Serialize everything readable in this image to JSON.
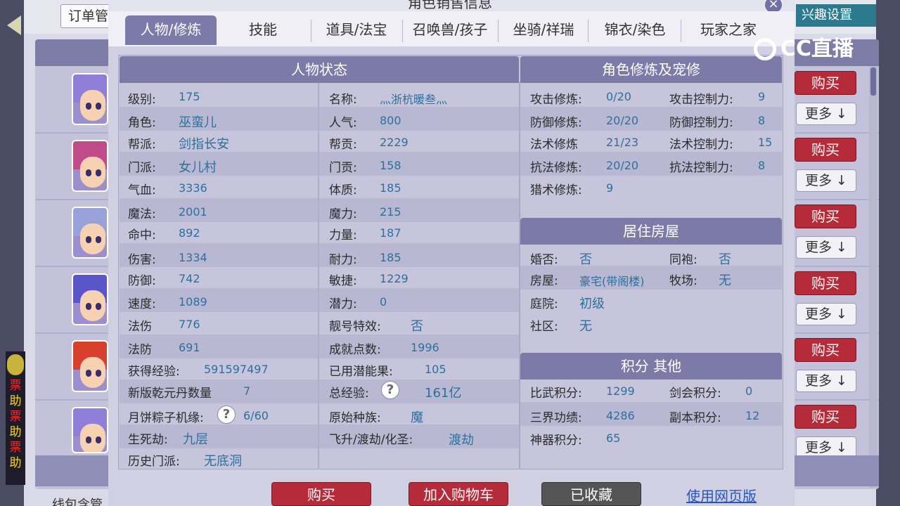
{
  "background": {
    "order_label": "订单管",
    "buy_label": "购买",
    "more_label": "更多 ↓",
    "brand_text": "兴趣设置",
    "bottom_text": "线包含管",
    "left_strip_glyphs": [
      "票",
      "助",
      "票",
      "助",
      "票",
      "助"
    ]
  },
  "dialog": {
    "title": "角色销售信息",
    "close": "×"
  },
  "tabs": [
    {
      "label": "人物/修炼"
    },
    {
      "label": "技能"
    },
    {
      "label": "道具/法宝"
    },
    {
      "label": "召唤兽/孩子"
    },
    {
      "label": "坐骑/祥瑞"
    },
    {
      "label": "锦衣/染色"
    },
    {
      "label": "玩家之家"
    }
  ],
  "watermark": "CC直播",
  "sections": {
    "status": "人物状态",
    "cultivation": "角色修炼及宠修",
    "house": "居住房屋",
    "points": "积分 其他"
  },
  "status_left": [
    {
      "label": "级别:",
      "value": "175"
    },
    {
      "label": "角色:",
      "value": "巫蛮儿"
    },
    {
      "label": "帮派:",
      "value": "剑指长安"
    },
    {
      "label": "门派:",
      "value": "女儿村"
    },
    {
      "label": "气血:",
      "value": "3336"
    },
    {
      "label": "魔法:",
      "value": "2001"
    },
    {
      "label": "命中:",
      "value": "892"
    },
    {
      "label": "伤害:",
      "value": "1334"
    },
    {
      "label": "防御:",
      "value": "742"
    },
    {
      "label": "速度:",
      "value": "1089"
    },
    {
      "label": "法伤",
      "value": "776"
    },
    {
      "label": "法防",
      "value": "691"
    },
    {
      "label": "获得经验:",
      "value": "591597497"
    },
    {
      "label": "新版乾元丹数量",
      "value": "7"
    },
    {
      "label": "月饼粽子机缘:",
      "value": "6/60"
    },
    {
      "label": "生死劫:",
      "value": "九层"
    },
    {
      "label": "历史门派:",
      "value": "无底洞"
    }
  ],
  "status_right": [
    {
      "label": "名称:",
      "value": "灬浙杭暖叁灬"
    },
    {
      "label": "人气:",
      "value": "800"
    },
    {
      "label": "帮贡:",
      "value": "2229"
    },
    {
      "label": "门贡:",
      "value": "158"
    },
    {
      "label": "体质:",
      "value": "185"
    },
    {
      "label": "魔力:",
      "value": "215"
    },
    {
      "label": "力量:",
      "value": "187"
    },
    {
      "label": "耐力:",
      "value": "185"
    },
    {
      "label": "敏捷:",
      "value": "1229"
    },
    {
      "label": "潜力:",
      "value": "0"
    },
    {
      "label": "靓号特效:",
      "value": "否"
    },
    {
      "label": "成就点数:",
      "value": "1996"
    },
    {
      "label": "已用潜能果:",
      "value": "105"
    },
    {
      "label": "总经验:",
      "value": "161亿"
    },
    {
      "label": "原始种族:",
      "value": "魔"
    },
    {
      "label": "飞升/渡劫/化圣:",
      "value": "渡劫"
    }
  ],
  "cultivation": [
    {
      "label": "攻击修炼:",
      "value": "0/20",
      "label2": "攻击控制力:",
      "value2": "9"
    },
    {
      "label": "防御修炼:",
      "value": "20/20",
      "label2": "防御控制力:",
      "value2": "8"
    },
    {
      "label": "法术修炼",
      "value": "21/23",
      "label2": "法术控制力:",
      "value2": "15"
    },
    {
      "label": "抗法修炼:",
      "value": "20/20",
      "label2": "抗法控制力:",
      "value2": "8"
    },
    {
      "label": "猎术修炼:",
      "value": "9",
      "label2": "",
      "value2": ""
    }
  ],
  "house": [
    {
      "label": "婚否:",
      "value": "否",
      "label2": "同袍:",
      "value2": "否"
    },
    {
      "label": "房屋:",
      "value": "豪宅(带阁楼)",
      "label2": "牧场:",
      "value2": "无"
    },
    {
      "label": "庭院:",
      "value": "初级",
      "label2": "",
      "value2": ""
    },
    {
      "label": "社区:",
      "value": "无",
      "label2": "",
      "value2": ""
    }
  ],
  "points": [
    {
      "label": "比武积分:",
      "value": "1299",
      "label2": "剑会积分:",
      "value2": "0"
    },
    {
      "label": "三界功绩:",
      "value": "4286",
      "label2": "副本积分:",
      "value2": "12"
    },
    {
      "label": "神器积分:",
      "value": "65",
      "label2": "",
      "value2": ""
    }
  ],
  "help_mark": "?",
  "buttons": {
    "buy": "购买",
    "add_cart": "加入购物车",
    "collected": "已收藏",
    "web_version": "使用网页版"
  },
  "colors": {
    "buy_red": "#b62b3a",
    "collected_gray": "#555555",
    "header_purple": "#7c7ba7",
    "value_blue": "#2f6f9a"
  }
}
